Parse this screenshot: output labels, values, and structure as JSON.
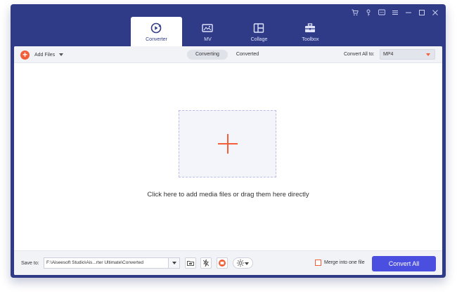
{
  "window_controls": [
    {
      "name": "cart-icon"
    },
    {
      "name": "key-icon"
    },
    {
      "name": "feedback-icon"
    },
    {
      "name": "menu-icon"
    },
    {
      "name": "minimize-icon"
    },
    {
      "name": "maximize-icon"
    },
    {
      "name": "close-icon"
    }
  ],
  "tabs": [
    {
      "label": "Converter",
      "icon": "converter-icon",
      "active": true
    },
    {
      "label": "MV",
      "icon": "mv-icon",
      "active": false
    },
    {
      "label": "Collage",
      "icon": "collage-icon",
      "active": false
    },
    {
      "label": "Toolbox",
      "icon": "toolbox-icon",
      "active": false
    }
  ],
  "toolbar": {
    "add_files_label": "Add Files",
    "segments": [
      {
        "label": "Converting",
        "active": true
      },
      {
        "label": "Converted",
        "active": false
      }
    ],
    "convert_all_to_label": "Convert All to:",
    "format_value": "MP4"
  },
  "main": {
    "hint": "Click here to add media files or drag them here directly"
  },
  "bottom": {
    "save_to_label": "Save to:",
    "path_value": "F:\\Aiseesoft Studio\\Ais...rter Ultimate\\Converted",
    "merge_label": "Merge into one file",
    "convert_all_label": "Convert All"
  },
  "colors": {
    "frame": "#2f3b87",
    "accent": "#f25e38",
    "convert_button": "#4b4fe0"
  }
}
